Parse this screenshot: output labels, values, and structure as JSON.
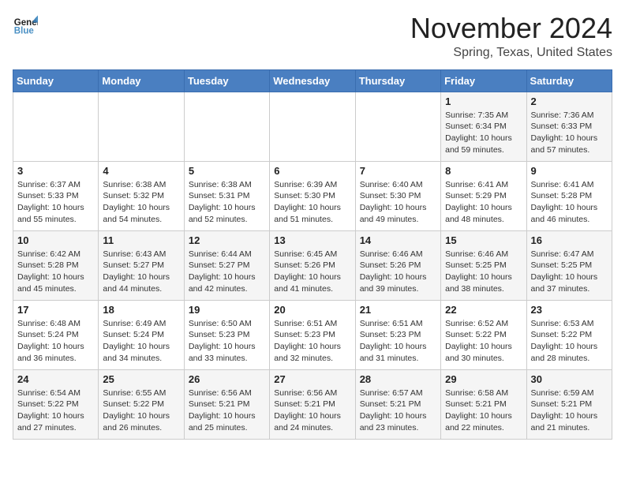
{
  "header": {
    "logo_line1": "General",
    "logo_line2": "Blue",
    "month": "November 2024",
    "location": "Spring, Texas, United States"
  },
  "days_of_week": [
    "Sunday",
    "Monday",
    "Tuesday",
    "Wednesday",
    "Thursday",
    "Friday",
    "Saturday"
  ],
  "weeks": [
    [
      {
        "day": "",
        "info": ""
      },
      {
        "day": "",
        "info": ""
      },
      {
        "day": "",
        "info": ""
      },
      {
        "day": "",
        "info": ""
      },
      {
        "day": "",
        "info": ""
      },
      {
        "day": "1",
        "info": "Sunrise: 7:35 AM\nSunset: 6:34 PM\nDaylight: 10 hours and 59 minutes."
      },
      {
        "day": "2",
        "info": "Sunrise: 7:36 AM\nSunset: 6:33 PM\nDaylight: 10 hours and 57 minutes."
      }
    ],
    [
      {
        "day": "3",
        "info": "Sunrise: 6:37 AM\nSunset: 5:33 PM\nDaylight: 10 hours and 55 minutes."
      },
      {
        "day": "4",
        "info": "Sunrise: 6:38 AM\nSunset: 5:32 PM\nDaylight: 10 hours and 54 minutes."
      },
      {
        "day": "5",
        "info": "Sunrise: 6:38 AM\nSunset: 5:31 PM\nDaylight: 10 hours and 52 minutes."
      },
      {
        "day": "6",
        "info": "Sunrise: 6:39 AM\nSunset: 5:30 PM\nDaylight: 10 hours and 51 minutes."
      },
      {
        "day": "7",
        "info": "Sunrise: 6:40 AM\nSunset: 5:30 PM\nDaylight: 10 hours and 49 minutes."
      },
      {
        "day": "8",
        "info": "Sunrise: 6:41 AM\nSunset: 5:29 PM\nDaylight: 10 hours and 48 minutes."
      },
      {
        "day": "9",
        "info": "Sunrise: 6:41 AM\nSunset: 5:28 PM\nDaylight: 10 hours and 46 minutes."
      }
    ],
    [
      {
        "day": "10",
        "info": "Sunrise: 6:42 AM\nSunset: 5:28 PM\nDaylight: 10 hours and 45 minutes."
      },
      {
        "day": "11",
        "info": "Sunrise: 6:43 AM\nSunset: 5:27 PM\nDaylight: 10 hours and 44 minutes."
      },
      {
        "day": "12",
        "info": "Sunrise: 6:44 AM\nSunset: 5:27 PM\nDaylight: 10 hours and 42 minutes."
      },
      {
        "day": "13",
        "info": "Sunrise: 6:45 AM\nSunset: 5:26 PM\nDaylight: 10 hours and 41 minutes."
      },
      {
        "day": "14",
        "info": "Sunrise: 6:46 AM\nSunset: 5:26 PM\nDaylight: 10 hours and 39 minutes."
      },
      {
        "day": "15",
        "info": "Sunrise: 6:46 AM\nSunset: 5:25 PM\nDaylight: 10 hours and 38 minutes."
      },
      {
        "day": "16",
        "info": "Sunrise: 6:47 AM\nSunset: 5:25 PM\nDaylight: 10 hours and 37 minutes."
      }
    ],
    [
      {
        "day": "17",
        "info": "Sunrise: 6:48 AM\nSunset: 5:24 PM\nDaylight: 10 hours and 36 minutes."
      },
      {
        "day": "18",
        "info": "Sunrise: 6:49 AM\nSunset: 5:24 PM\nDaylight: 10 hours and 34 minutes."
      },
      {
        "day": "19",
        "info": "Sunrise: 6:50 AM\nSunset: 5:23 PM\nDaylight: 10 hours and 33 minutes."
      },
      {
        "day": "20",
        "info": "Sunrise: 6:51 AM\nSunset: 5:23 PM\nDaylight: 10 hours and 32 minutes."
      },
      {
        "day": "21",
        "info": "Sunrise: 6:51 AM\nSunset: 5:23 PM\nDaylight: 10 hours and 31 minutes."
      },
      {
        "day": "22",
        "info": "Sunrise: 6:52 AM\nSunset: 5:22 PM\nDaylight: 10 hours and 30 minutes."
      },
      {
        "day": "23",
        "info": "Sunrise: 6:53 AM\nSunset: 5:22 PM\nDaylight: 10 hours and 28 minutes."
      }
    ],
    [
      {
        "day": "24",
        "info": "Sunrise: 6:54 AM\nSunset: 5:22 PM\nDaylight: 10 hours and 27 minutes."
      },
      {
        "day": "25",
        "info": "Sunrise: 6:55 AM\nSunset: 5:22 PM\nDaylight: 10 hours and 26 minutes."
      },
      {
        "day": "26",
        "info": "Sunrise: 6:56 AM\nSunset: 5:21 PM\nDaylight: 10 hours and 25 minutes."
      },
      {
        "day": "27",
        "info": "Sunrise: 6:56 AM\nSunset: 5:21 PM\nDaylight: 10 hours and 24 minutes."
      },
      {
        "day": "28",
        "info": "Sunrise: 6:57 AM\nSunset: 5:21 PM\nDaylight: 10 hours and 23 minutes."
      },
      {
        "day": "29",
        "info": "Sunrise: 6:58 AM\nSunset: 5:21 PM\nDaylight: 10 hours and 22 minutes."
      },
      {
        "day": "30",
        "info": "Sunrise: 6:59 AM\nSunset: 5:21 PM\nDaylight: 10 hours and 21 minutes."
      }
    ]
  ]
}
